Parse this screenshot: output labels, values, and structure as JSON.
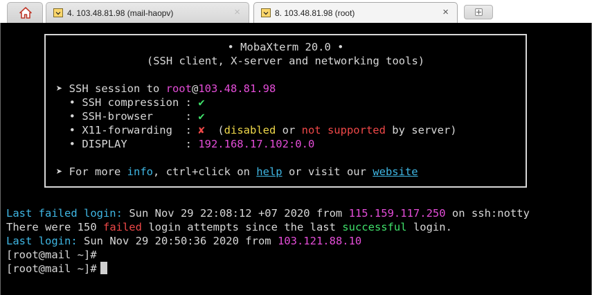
{
  "tabs": [
    {
      "label": "4. 103.48.81.98 (mail-haopv)",
      "close": "×",
      "active": false
    },
    {
      "label": "8. 103.48.81.98 (root)",
      "close": "×",
      "active": true
    }
  ],
  "banner": {
    "title": "• MobaXterm 20.0 •",
    "subtitle": "(SSH client, X-server and networking tools)",
    "session_prefix": "➤ SSH session to ",
    "session_user": "root",
    "session_at": "@",
    "session_host": "103.48.81.98",
    "compression_label": "  • SSH compression : ",
    "compression_value": "✔",
    "browser_label": "  • SSH-browser     : ",
    "browser_value": "✔",
    "x11_label": "  • X11-forwarding  : ",
    "x11_value": "✘",
    "x11_note_open": "  (",
    "x11_disabled": "disabled",
    "x11_or": " or ",
    "x11_not_supported": "not supported",
    "x11_note_close": " by server)",
    "display_label": "  • DISPLAY         : ",
    "display_value": "192.168.17.102:0.0",
    "more_prefix": "➤ For more ",
    "more_info": "info",
    "more_mid": ", ctrl+click on ",
    "more_help": "help",
    "more_or": " or visit our ",
    "more_website": "website"
  },
  "output": {
    "failed_label": "Last failed login:",
    "failed_date": " Sun Nov 29 22:08:12 +07 2020 from ",
    "failed_ip": "115.159.117.250",
    "failed_tail": " on ssh:notty",
    "attempts_pre": "There were 150 ",
    "attempts_failed": "failed",
    "attempts_mid": " login attempts since the last ",
    "attempts_success": "successful",
    "attempts_tail": " login.",
    "last_label": "Last login:",
    "last_date": " Sun Nov 29 20:50:36 2020 from ",
    "last_ip": "103.121.88.10",
    "prompt1": "[root@mail ~]#",
    "prompt2": "[root@mail ~]#"
  },
  "colors": {
    "terminal_bg": "#000000",
    "text": "#d8d8d8",
    "green": "#3fe06a",
    "yellow": "#efd84a",
    "magenta": "#e44dd8",
    "cyan": "#3fb7e4",
    "red": "#ef4848"
  },
  "icons": [
    "home-icon",
    "terminal-tab-icon",
    "close-icon",
    "new-tab-icon"
  ]
}
